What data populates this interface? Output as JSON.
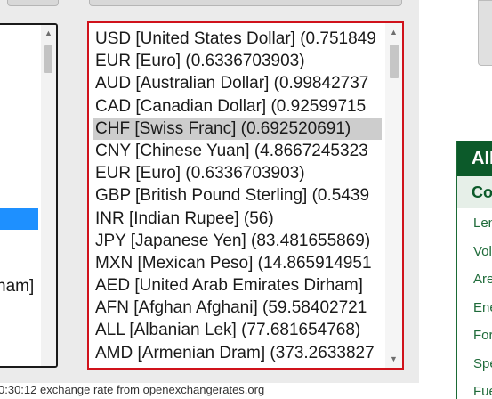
{
  "left_list": {
    "visible_item": "ham]"
  },
  "right_list": {
    "items": [
      "USD [United States Dollar] (0.751849",
      "EUR [Euro] (0.6336703903)",
      "AUD [Australian Dollar] (0.99842737",
      "CAD [Canadian Dollar] (0.92599715",
      "CHF [Swiss Franc] (0.692520691)",
      "CNY [Chinese Yuan] (4.8667245323",
      "EUR [Euro] (0.6336703903)",
      "GBP [British Pound Sterling] (0.5439",
      "INR [Indian Rupee] (56)",
      "JPY [Japanese Yen] (83.481655869)",
      "MXN [Mexican Peso] (14.865914951",
      "AED [United Arab Emirates Dirham]",
      "AFN [Afghan Afghani] (59.58402721",
      "ALL [Albanian Lek] (77.681654768)",
      "AMD [Armenian Dram] (373.2633827"
    ],
    "selected_index": 4
  },
  "footer": {
    "text": "0:30:12 exchange rate from openexchangerates.org"
  },
  "side_nav": {
    "heading": "All",
    "subheading": "Co",
    "links": [
      "Len",
      "Vol",
      "Are",
      "Ene",
      "For",
      "Spe",
      "Fue"
    ]
  },
  "icons": {
    "scroll_up": "scroll-up-arrow-icon",
    "scroll_down": "scroll-down-arrow-icon"
  },
  "colors": {
    "focus_border": "#d0121b",
    "selection_highlight": "#1e90ff",
    "nav_green": "#0c5a2a"
  }
}
